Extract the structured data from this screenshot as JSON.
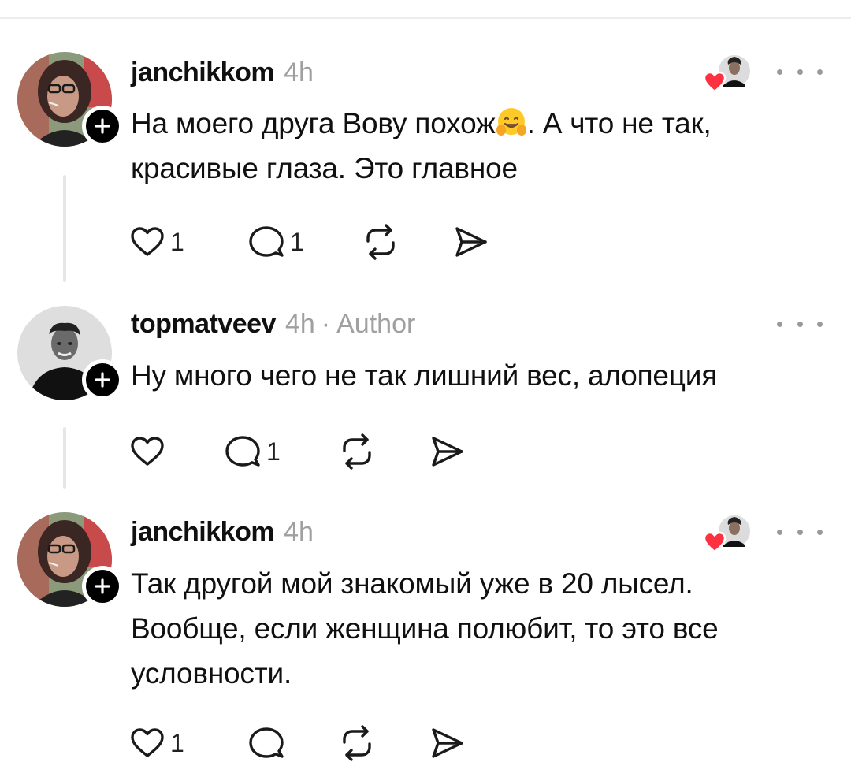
{
  "posts": [
    {
      "username": "janchikkom",
      "time": "4h",
      "text_before_emoji": "На моего друга Вову похож",
      "emoji": "hugging-face",
      "text_after_emoji": ". А что не так, красивые глаза. Это главное",
      "likes": "1",
      "replies": "1",
      "liked_by_author": true
    },
    {
      "username": "topmatveev",
      "time": "4h",
      "separator": "·",
      "author_badge": "Author",
      "text": "Ну много чего не так лишний вес, алопеция",
      "likes": "",
      "replies": "1",
      "liked_by_author": false
    },
    {
      "username": "janchikkom",
      "time": "4h",
      "text": "Так другой мой знакомый уже в 20 лысел. Вообще, если женщина полюбит, то это все условности.",
      "likes": "1",
      "replies": "",
      "liked_by_author": true
    }
  ],
  "icons": {
    "like": "heart-outline-icon",
    "reply": "speech-bubble-icon",
    "repost": "repost-icon",
    "share": "send-icon",
    "follow": "plus-icon",
    "more": "more-dots-icon"
  },
  "colors": {
    "text": "#101010",
    "muted": "#a0a0a0",
    "heart_red": "#ff3040",
    "thread_line": "#e6e6e6"
  }
}
